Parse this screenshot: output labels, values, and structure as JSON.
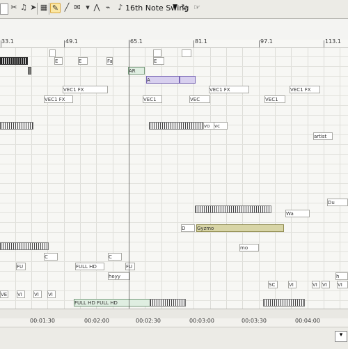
{
  "toolbar": {
    "swing_label": "16th Note Swing",
    "swing_arrow": "▼"
  },
  "ruler": {
    "labels": [
      "33.1",
      "49.1",
      "65.1",
      "81.1",
      "97.1",
      "113.1"
    ]
  },
  "clips": {
    "vec1_fx_1": "VEC1 FX",
    "vec1_fx_2": "VEC1 FX",
    "vec1_fx_3": "VEC1 FX",
    "vec1_fx_4": "VEC1 FX",
    "vec1_1": "VEC1",
    "vec1_2": "VEC1",
    "vec": "VEC",
    "ar": "AR",
    "artist": "artist",
    "gyzmo": "Gyzmo",
    "full_hd_1": "FULL HD",
    "full_hd_2": "FULL HD",
    "full_hd_3": "FULL HD",
    "heyy": "heyy",
    "mo": "mo",
    "vo": "vo",
    "vc": "vc",
    "wa": "Wa",
    "du": "Du",
    "c1": "C",
    "c2": "C",
    "e": "E",
    "d": "D",
    "a": "A",
    "fu": "FU",
    "fu2": "FU",
    "ve": "VE",
    "vi": "VI",
    "gy": "Gy",
    "sc": "SC",
    "h": "h",
    "fa": "Fa"
  },
  "timeline": {
    "times": [
      "00:01:30",
      "00:02:00",
      "00:02:30",
      "00:03:00",
      "00:03:30",
      "00:04:00"
    ]
  }
}
